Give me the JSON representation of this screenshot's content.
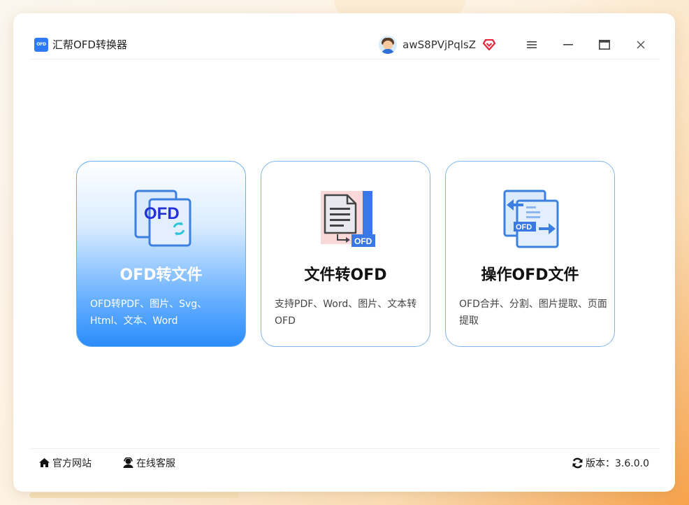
{
  "app": {
    "logo_text": "OFD",
    "title": "汇帮OFD转换器"
  },
  "user": {
    "name": "awS8PVjPqlsZ",
    "avatar_icon": "user-avatar",
    "vip_icon": "vip-diamond-icon"
  },
  "window_controls": {
    "menu_icon": "≡",
    "minimize_icon": "—",
    "maximize_icon": "▭",
    "close_icon": "×"
  },
  "cards": [
    {
      "title": "OFD转文件",
      "desc": "OFD转PDF、图片、Svg、Html、文本、Word",
      "icon_text": "OFD",
      "selected": true
    },
    {
      "title": "文件转OFD",
      "desc": "支持PDF、Word、图片、文本转OFD",
      "icon_text": "OFD",
      "selected": false
    },
    {
      "title": "操作OFD文件",
      "desc": "OFD合并、分割、图片提取、页面提取",
      "icon_text": "OFD",
      "selected": false
    }
  ],
  "footer": {
    "home_label": "官方网站",
    "service_label": "在线客服",
    "version_label": "版本：3.6.0.0"
  },
  "colors": {
    "accent": "#2b8cfb",
    "card_border": "#7fb5ec",
    "vip": "#e8253a"
  }
}
